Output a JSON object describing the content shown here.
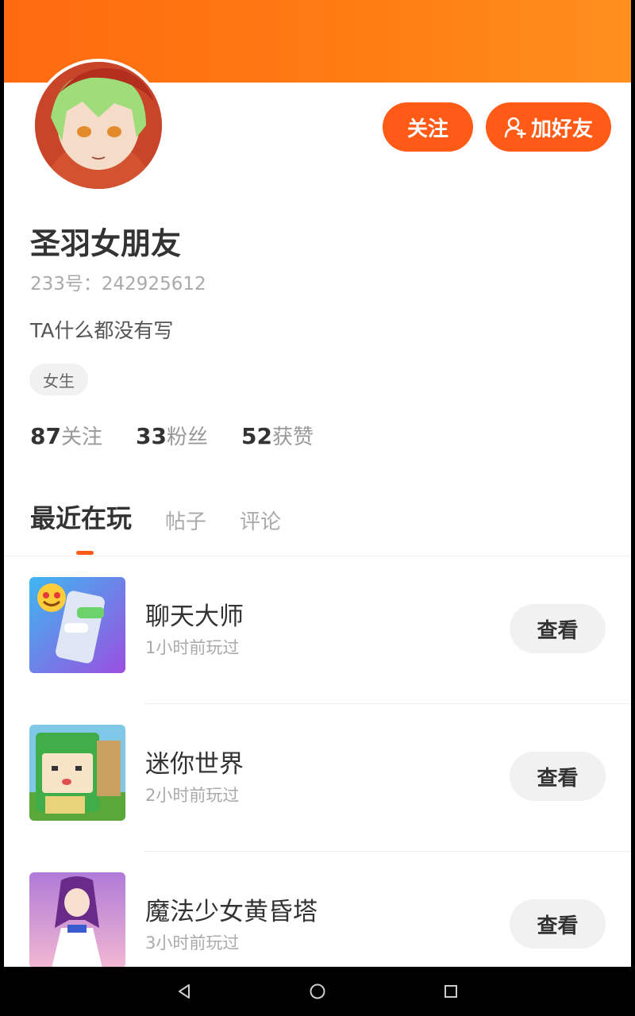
{
  "profile": {
    "name": "圣羽女朋友",
    "id_line": "233号：242925612",
    "bio": "TA什么都没有写",
    "gender_tag": "女生"
  },
  "actions": {
    "follow_label": "关注",
    "add_friend_label": "加好友"
  },
  "stats": [
    {
      "count": "87",
      "label": "关注"
    },
    {
      "count": "33",
      "label": "粉丝"
    },
    {
      "count": "52",
      "label": "获赞"
    }
  ],
  "tabs": [
    {
      "label": "最近在玩",
      "active": true
    },
    {
      "label": "帖子",
      "active": false
    },
    {
      "label": "评论",
      "active": false
    }
  ],
  "games": [
    {
      "name": "聊天大师",
      "played": "1小时前玩过",
      "action": "查看",
      "icon": "chat-master-game-icon"
    },
    {
      "name": "迷你世界",
      "played": "2小时前玩过",
      "action": "查看",
      "icon": "mini-world-game-icon"
    },
    {
      "name": "魔法少女黄昏塔",
      "played": "3小时前玩过",
      "action": "查看",
      "icon": "magic-girl-tower-game-icon"
    }
  ],
  "colors": {
    "accent": "#ff5a16",
    "banner_start": "#ff6a10",
    "banner_end": "#ff8f1f"
  },
  "system_nav": {
    "back_icon": "back-triangle-icon",
    "home_icon": "home-circle-icon",
    "recents_icon": "recents-square-icon"
  }
}
